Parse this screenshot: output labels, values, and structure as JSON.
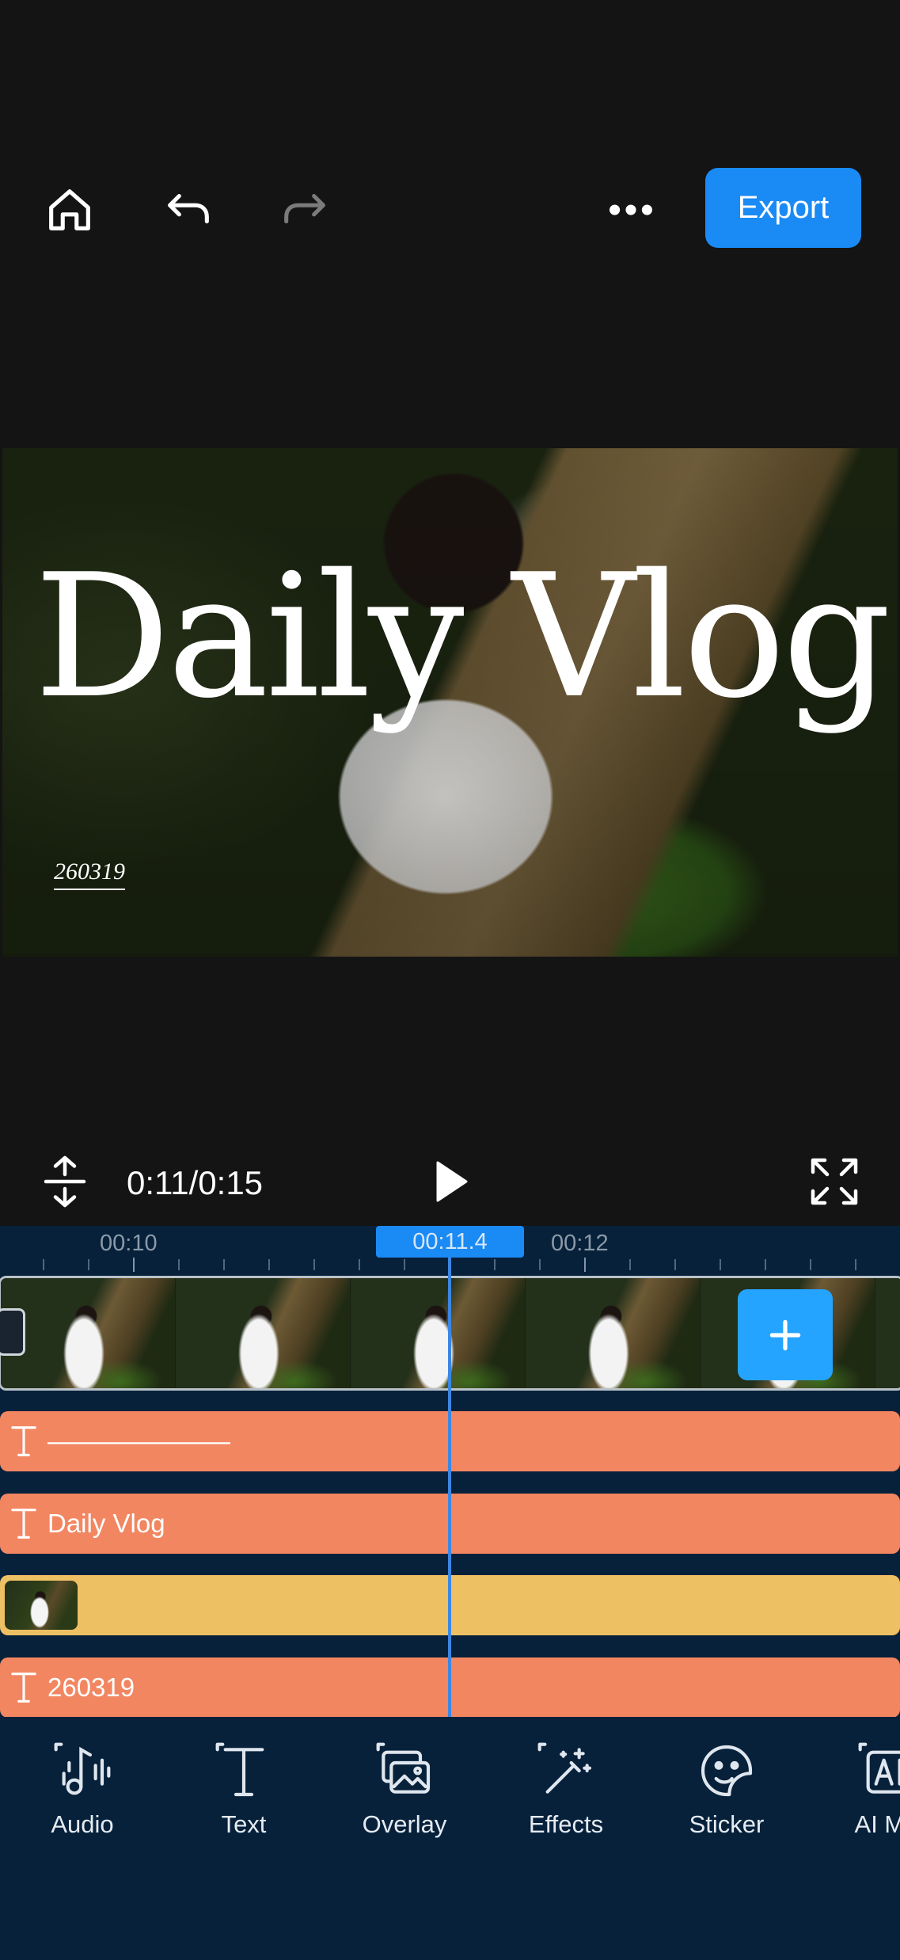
{
  "toolbar": {
    "icons": [
      "home-icon",
      "undo-icon",
      "redo-icon",
      "more-icon"
    ],
    "export_label": "Export",
    "export_color": "#1a8af5"
  },
  "preview": {
    "title_text": "Daily Vlog",
    "date_text": "260319"
  },
  "playback": {
    "timecode": "0:11/0:15",
    "icons": [
      "split-height-icon",
      "play-icon",
      "fullscreen-icon"
    ]
  },
  "timeline": {
    "ruler_labels": [
      "00:10",
      "00:12"
    ],
    "current_time": "00:11.4",
    "tracks": [
      {
        "type": "text",
        "label": "———————",
        "color": "#f28661"
      },
      {
        "type": "text",
        "label": "Daily Vlog",
        "color": "#f28661"
      },
      {
        "type": "overlay",
        "label": "",
        "color": "#eec064"
      },
      {
        "type": "text",
        "label": "260319",
        "color": "#f28661"
      }
    ],
    "add_clip_icon": "plus-icon"
  },
  "tools": [
    {
      "label": "Audio",
      "icon": "audio-icon"
    },
    {
      "label": "Text",
      "icon": "text-icon"
    },
    {
      "label": "Overlay",
      "icon": "overlay-icon"
    },
    {
      "label": "Effects",
      "icon": "effects-icon"
    },
    {
      "label": "Sticker",
      "icon": "sticker-icon"
    },
    {
      "label": "AI Ma",
      "icon": "ai-icon"
    }
  ]
}
